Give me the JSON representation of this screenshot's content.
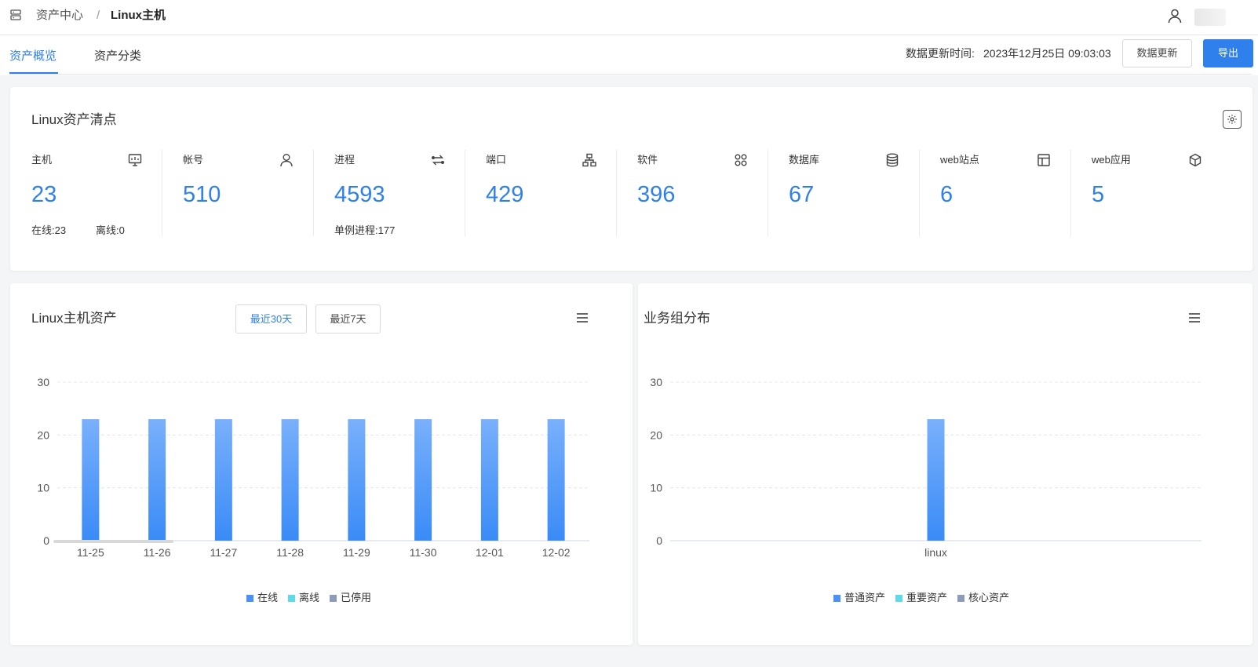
{
  "header": {
    "breadcrumb_parent": "资产中心",
    "breadcrumb_separator": "/",
    "breadcrumb_current": "Linux主机"
  },
  "tabs": {
    "overview": "资产概览",
    "category": "资产分类"
  },
  "toolbar": {
    "update_label": "数据更新时间:",
    "update_time": "2023年12月25日 09:03:03",
    "refresh_label": "数据更新",
    "export_label": "导出"
  },
  "inventory": {
    "title": "Linux资产清点",
    "stats": [
      {
        "label": "主机",
        "value": "23",
        "icon": "monitor-icon"
      },
      {
        "label": "帐号",
        "value": "510",
        "icon": "user-icon"
      },
      {
        "label": "进程",
        "value": "4593",
        "icon": "swap-icon"
      },
      {
        "label": "端口",
        "value": "429",
        "icon": "network-icon"
      },
      {
        "label": "软件",
        "value": "396",
        "icon": "apps-icon"
      },
      {
        "label": "数据库",
        "value": "67",
        "icon": "database-icon"
      },
      {
        "label": "web站点",
        "value": "6",
        "icon": "layout-icon"
      },
      {
        "label": "web应用",
        "value": "5",
        "icon": "cube-icon"
      }
    ],
    "host_online": "在线:23",
    "host_offline": "离线:0",
    "process_single": "单例进程:177"
  },
  "host_chart": {
    "title": "Linux主机资产",
    "range_30": "最近30天",
    "range_7": "最近7天"
  },
  "group_chart": {
    "title": "业务组分布"
  },
  "colors": {
    "accent": "#2f80ed",
    "bar_top": "#79b0fb",
    "bar_bottom": "#3a8bf7",
    "legend_online": "#4a90f7",
    "legend_offline": "#5fdbe8",
    "legend_disabled": "#8c9bb8"
  },
  "chart_data": [
    {
      "type": "bar",
      "categories": [
        "11-25",
        "11-26",
        "11-27",
        "11-28",
        "11-29",
        "11-30",
        "12-01",
        "12-02"
      ],
      "series": [
        {
          "name": "在线",
          "values": [
            23,
            23,
            23,
            23,
            23,
            23,
            23,
            23
          ]
        },
        {
          "name": "离线",
          "values": [
            0,
            0,
            0,
            0,
            0,
            0,
            0,
            0
          ]
        },
        {
          "name": "已停用",
          "values": [
            0,
            0,
            0,
            0,
            0,
            0,
            0,
            0
          ]
        }
      ],
      "yticks": [
        "0",
        "10",
        "20",
        "30"
      ],
      "ylim": [
        0,
        30
      ],
      "grid": true,
      "legend": "bottom"
    },
    {
      "type": "bar",
      "categories": [
        "linux"
      ],
      "series": [
        {
          "name": "普通资产",
          "values": [
            23
          ]
        },
        {
          "name": "重要资产",
          "values": [
            0
          ]
        },
        {
          "name": "核心资产",
          "values": [
            0
          ]
        }
      ],
      "yticks": [
        "0",
        "10",
        "20",
        "30"
      ],
      "ylim": [
        0,
        30
      ],
      "grid": true,
      "legend": "bottom"
    }
  ]
}
